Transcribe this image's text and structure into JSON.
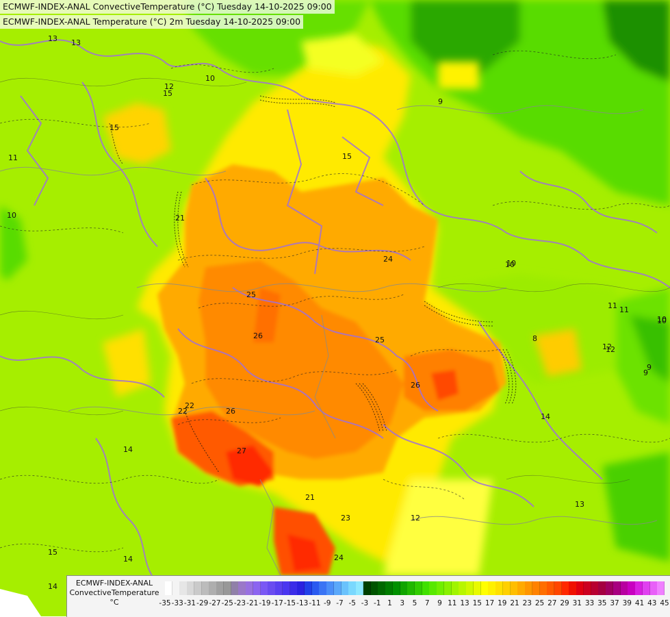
{
  "titles": {
    "line1": "ECMWF-INDEX-ANAL ConvectiveTemperature (°C) Tuesday 14-10-2025 09:00",
    "line2": "ECMWF-INDEX-ANAL Temperature (°C) 2m Tuesday 14-10-2025 09:00"
  },
  "legend": {
    "model": "ECMWF-INDEX-ANAL",
    "parameter": "ConvectiveTemperature",
    "unit": "°C",
    "ticks": [
      "-35",
      "-33",
      "-31",
      "-29",
      "-27",
      "-25",
      "-23",
      "-21",
      "-19",
      "-17",
      "-15",
      "-13",
      "-11",
      "-9",
      "-7",
      "-5",
      "-3",
      "-1",
      "1",
      "3",
      "5",
      "7",
      "9",
      "11",
      "13",
      "15",
      "17",
      "19",
      "21",
      "23",
      "25",
      "27",
      "29",
      "31",
      "33",
      "35",
      "37",
      "39",
      "41",
      "43",
      "45"
    ],
    "colors": [
      "#ffffff",
      "#f4f4f4",
      "#e6e6e6",
      "#d8d8d8",
      "#cacaca",
      "#bcbcbc",
      "#aeaeae",
      "#a0a0a0",
      "#989898",
      "#9080a8",
      "#9a78c8",
      "#9870e0",
      "#8c64f0",
      "#7a58f4",
      "#6a4cf0",
      "#5a40f0",
      "#4a36f0",
      "#3a2ce8",
      "#2a22e0",
      "#2040e8",
      "#2a5af0",
      "#3a74f4",
      "#4a8ef8",
      "#5aa8fa",
      "#6ac2fc",
      "#7ad8fe",
      "#8ee8ff",
      "#004000",
      "#005400",
      "#006800",
      "#007c00",
      "#009000",
      "#10a400",
      "#20b800",
      "#30cc00",
      "#40e000",
      "#58e800",
      "#70ee00",
      "#88f000",
      "#a0f400",
      "#b8f600",
      "#d0f800",
      "#e8fa00",
      "#ffff00",
      "#fff000",
      "#ffe000",
      "#ffd000",
      "#ffbe00",
      "#ffaa00",
      "#ff9600",
      "#ff8200",
      "#ff6e00",
      "#ff5a00",
      "#ff4600",
      "#ff2800",
      "#f01000",
      "#e00010",
      "#cc0020",
      "#b80030",
      "#a40040",
      "#a00060",
      "#a80080",
      "#b800a0",
      "#c800c0",
      "#d820e0",
      "#e040f0",
      "#e860f8",
      "#f080ff"
    ]
  },
  "contour_labels": [
    "10",
    "11",
    "11",
    "15",
    "15",
    "14",
    "10",
    "10",
    "12",
    "12",
    "9",
    "9",
    "8",
    "12",
    "10",
    "14",
    "14",
    "13",
    "13",
    "15",
    "15",
    "24",
    "25",
    "25",
    "26",
    "26",
    "26",
    "27",
    "22",
    "21",
    "23",
    "24",
    "21",
    "14",
    "11",
    "10",
    "9",
    "12",
    "22",
    "10",
    "13"
  ],
  "colors": {
    "cool_green": "#5ee000",
    "lime": "#a8f000",
    "yellow": "#ffff20",
    "orange": "#ffa800",
    "deep_orange": "#ff7a00",
    "red": "#ff3000",
    "border_purple": "#a070d8",
    "country_line": "#9a9a9a"
  }
}
